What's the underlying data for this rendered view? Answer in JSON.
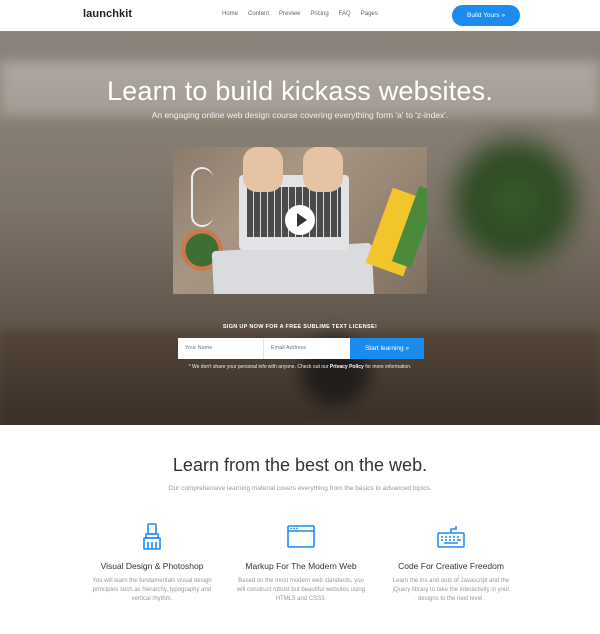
{
  "nav": {
    "logo": "launchkit",
    "menu": [
      "Home",
      "Content",
      "Preview",
      "Pricing",
      "FAQ",
      "Pages"
    ],
    "cta": "Build Yours »"
  },
  "hero": {
    "title": "Learn to build kickass websites.",
    "subtitle": "An engaging online web design course covering everything form 'a' to 'z-index'.",
    "signup_label": "SIGN UP NOW FOR A FREE SUBLIME TEXT LICENSE!",
    "name_placeholder": "Your Name",
    "email_placeholder": "Email Address",
    "submit_label": "Start learning »",
    "disclaimer_pre": "* We don't share your personal info with anyone. Check out our ",
    "disclaimer_link": "Privacy Policy",
    "disclaimer_post": " for more information."
  },
  "features_section": {
    "title": "Learn from the best on the web.",
    "subtitle": "Our comprehensive learning material covers everything from the basics to advanced topics.",
    "items": [
      {
        "icon": "brush-icon",
        "title": "Visual Design & Photoshop",
        "desc": "You will learn the fundamentals visual design principles such as hierarchy, typography and vertical rhythm."
      },
      {
        "icon": "browser-window-icon",
        "title": "Markup For The Modern Web",
        "desc": "Based on the most modern web standards, you will construct robust but beautiful websites using HTML5 and CSS3."
      },
      {
        "icon": "keyboard-icon",
        "title": "Code For Creative Freedom",
        "desc": "Learn the ins and outs of Javascript and the jQuery library to take the interactivity in your designs to the next level."
      }
    ]
  },
  "colors": {
    "accent": "#1a8cf0",
    "icon_blue": "#1a8cf0"
  }
}
